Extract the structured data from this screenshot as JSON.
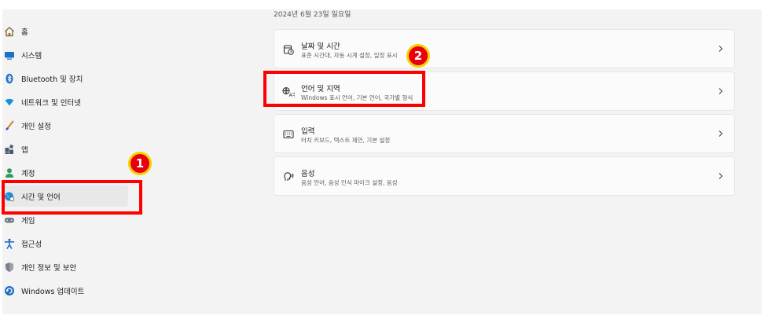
{
  "date_text": "2024년 6월 23일 일요일",
  "sidebar": {
    "items": [
      {
        "label": "홈",
        "icon": "home-icon"
      },
      {
        "label": "시스템",
        "icon": "monitor-icon"
      },
      {
        "label": "Bluetooth 및 장치",
        "icon": "bluetooth-icon"
      },
      {
        "label": "네트워크 및 인터넷",
        "icon": "network-icon"
      },
      {
        "label": "개인 설정",
        "icon": "brush-icon"
      },
      {
        "label": "앱",
        "icon": "apps-icon"
      },
      {
        "label": "계정",
        "icon": "account-icon"
      },
      {
        "label": "시간 및 언어",
        "icon": "globe-clock-icon"
      },
      {
        "label": "게임",
        "icon": "gamepad-icon"
      },
      {
        "label": "접근성",
        "icon": "accessibility-icon"
      },
      {
        "label": "개인 정보 및 보안",
        "icon": "shield-icon"
      },
      {
        "label": "Windows 업데이트",
        "icon": "update-icon"
      }
    ]
  },
  "cards": [
    {
      "title": "날짜 및 시간",
      "subtitle": "표준 시간대, 자동 시계 설정, 일정 표시",
      "icon": "calendar-clock-icon"
    },
    {
      "title": "언어 및 지역",
      "subtitle": "Windows 표시 언어, 기본 언어, 국가별 형식",
      "icon": "language-icon"
    },
    {
      "title": "입력",
      "subtitle": "터치 키보드, 텍스트 제안, 기본 설정",
      "icon": "keyboard-icon"
    },
    {
      "title": "음성",
      "subtitle": "음성 언어, 음성 인식 마이크 설정, 음성",
      "icon": "speech-icon"
    }
  ],
  "annotations": {
    "badge_1": "1",
    "badge_2": "2"
  },
  "colors": {
    "highlight": "#ff0000",
    "badge_fill": "#e8000b",
    "badge_ring": "#f5d000",
    "accent": "#0067c0"
  }
}
